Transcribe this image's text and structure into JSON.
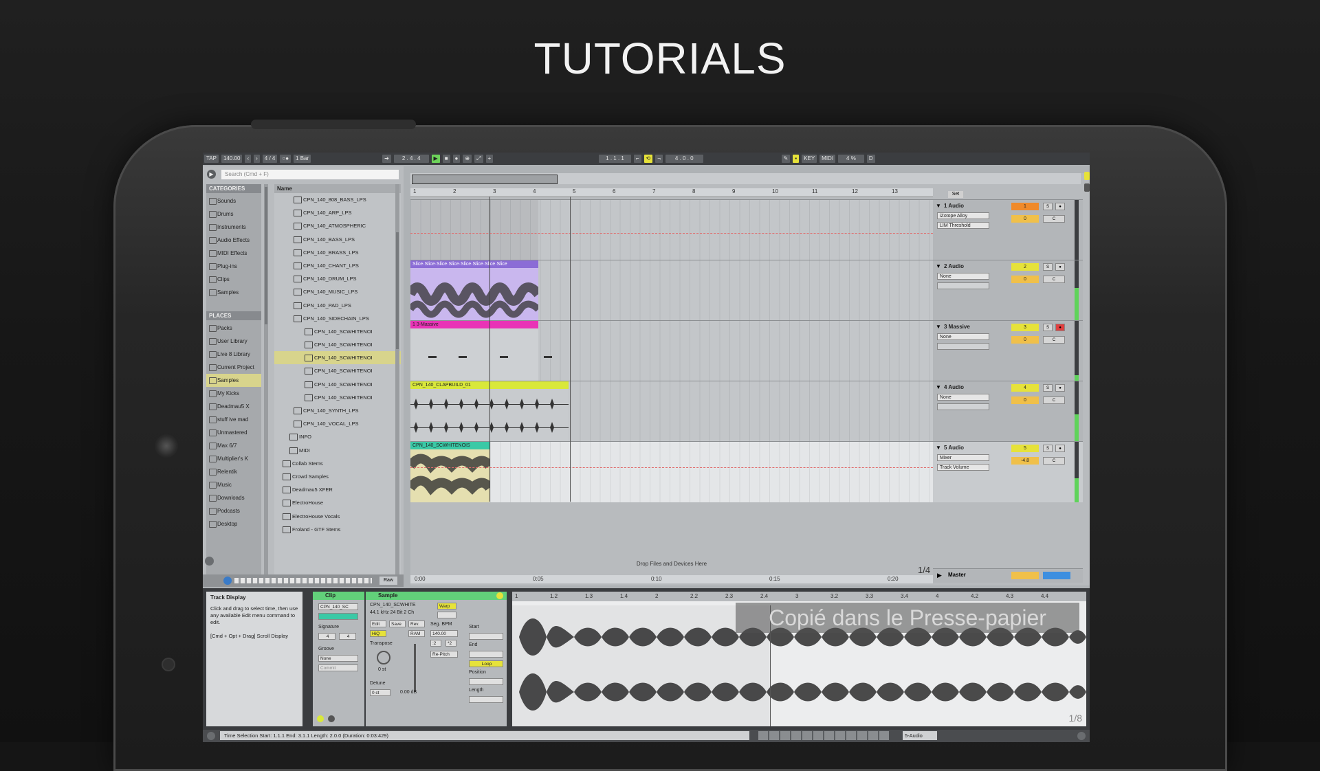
{
  "page": {
    "title": "TUTORIALS",
    "toast": "Copié dans le Presse-papier"
  },
  "transport": {
    "tap": "TAP",
    "tempo": "140.00",
    "meter": "4 / 4",
    "quant": "1 Bar",
    "position": "2 . 4 . 4",
    "loop_start": "1 . 1 . 1",
    "loop_len": "4 . 0 . 0",
    "key": "KEY",
    "midi": "MIDI",
    "cpu": "4 %"
  },
  "browser": {
    "search_placeholder": "Search (Cmd + F)",
    "categories_heading": "CATEGORIES",
    "categories": [
      "Sounds",
      "Drums",
      "Instruments",
      "Audio Effects",
      "MIDI Effects",
      "Plug-ins",
      "Clips",
      "Samples"
    ],
    "places_heading": "PLACES",
    "places": [
      "Packs",
      "User Library",
      "Live 8 Library",
      "Current Project",
      "Samples",
      "My Kicks",
      "Deadmau5 X",
      "stuff ive mad",
      "Unmastered",
      "Max 6/7",
      "Multiplier's K",
      "Relentik",
      "Music",
      "Downloads",
      "Podcasts",
      "Desktop"
    ],
    "name_heading": "Name",
    "files": [
      "CPN_140_808_BASS_LPS",
      "CPN_140_ARP_LPS",
      "CPN_140_ATMOSPHERIC",
      "CPN_140_BASS_LPS",
      "CPN_140_BRASS_LPS",
      "CPN_140_CHANT_LPS",
      "CPN_140_DRUM_LPS",
      "CPN_140_MUSIC_LPS",
      "CPN_140_PAD_LPS",
      "CPN_140_SIDECHAIN_LPS",
      "CPN_140_SCWHITENOI",
      "CPN_140_SCWHITENOI",
      "CPN_140_SCWHITENOI",
      "CPN_140_SCWHITENOI",
      "CPN_140_SCWHITENOI",
      "CPN_140_SCWHITENOI",
      "CPN_140_SYNTH_LPS",
      "CPN_140_VOCAL_LPS",
      "INFO",
      "MIDI",
      "Collab Stems",
      "Crowd Samples",
      "Deadmau5 XFER",
      "ElectroHouse",
      "ElectroHouse Vocals",
      "Froland - GTF Stems"
    ],
    "raw_label": "Raw"
  },
  "arrangement": {
    "ruler": [
      "1",
      "2",
      "3",
      "4",
      "5",
      "6",
      "7",
      "8",
      "9",
      "10",
      "11",
      "12",
      "13"
    ],
    "time_ruler": [
      "0:00",
      "0:05",
      "0:10",
      "0:15",
      "0:20"
    ],
    "zoom": "1/4",
    "drop_text": "Drop Files and Devices Here",
    "clips": {
      "massive": "1 3-Massive",
      "clap": "CPN_140_CLAPBUILD_01",
      "noise": "CPN_140_SCWHITENOIS"
    },
    "tracks": [
      {
        "name": "1 Audio",
        "dev1": "iZotope Alloy",
        "dev2": "LIM Threshold",
        "num": "1",
        "vol": "0"
      },
      {
        "name": "2 Audio",
        "dev1": "None",
        "num": "2",
        "vol": "0"
      },
      {
        "name": "3 Massive",
        "dev1": "None",
        "num": "3",
        "vol": "0"
      },
      {
        "name": "4 Audio",
        "dev1": "None",
        "num": "4",
        "vol": "0"
      },
      {
        "name": "5 Audio",
        "dev1": "Mixer",
        "dev2": "Track Volume",
        "num": "5",
        "vol": "-4.8"
      }
    ],
    "master": "Master",
    "set": "Set"
  },
  "detail": {
    "info_title": "Track Display",
    "info_text": "Click and drag to select time, then use any available Edit menu command to edit.",
    "info_text2": "[Cmd + Opt + Drag] Scroll Display",
    "clip_label": "Clip",
    "clip_name": "CPN_140_SC",
    "signature_label": "Signature",
    "sig_num": "4",
    "sig_den": "4",
    "groove_label": "Groove",
    "groove_val": "None",
    "commit": "Commit",
    "sample_label": "Sample",
    "sample_name": "CPN_140_SCWHITE",
    "sample_info": "44.1 kHz 24 Bit 2 Ch",
    "warp": "Warp",
    "edit": "Edit",
    "save": "Save",
    "rev": "Rev.",
    "hiq": "HiQ",
    "ram": "RAM",
    "seg_bpm": "Seg. BPM",
    "bpm_val": "140.00",
    "transpose": "Transpose",
    "transpose_val": "0 st",
    "detune": "Detune",
    "detune_val": "0 ct",
    "gain_val": "0.00 dB",
    "mode": "Re-Pitch",
    "start": "Start",
    "end": "End",
    "loop": "Loop",
    "position": "Position",
    "length": "Length",
    "ruler": [
      "1",
      "1.2",
      "1.3",
      "1.4",
      "2",
      "2.2",
      "2.3",
      "2.4",
      "3",
      "3.2",
      "3.3",
      "3.4",
      "4",
      "4.2",
      "4.3",
      "4.4"
    ],
    "zoom": "1/8"
  },
  "status": {
    "text": "Time Selection   Start: 1.1.1   End: 3.1.1   Length: 2.0.0 (Duration: 0:03:429)",
    "track": "5-Audio"
  }
}
